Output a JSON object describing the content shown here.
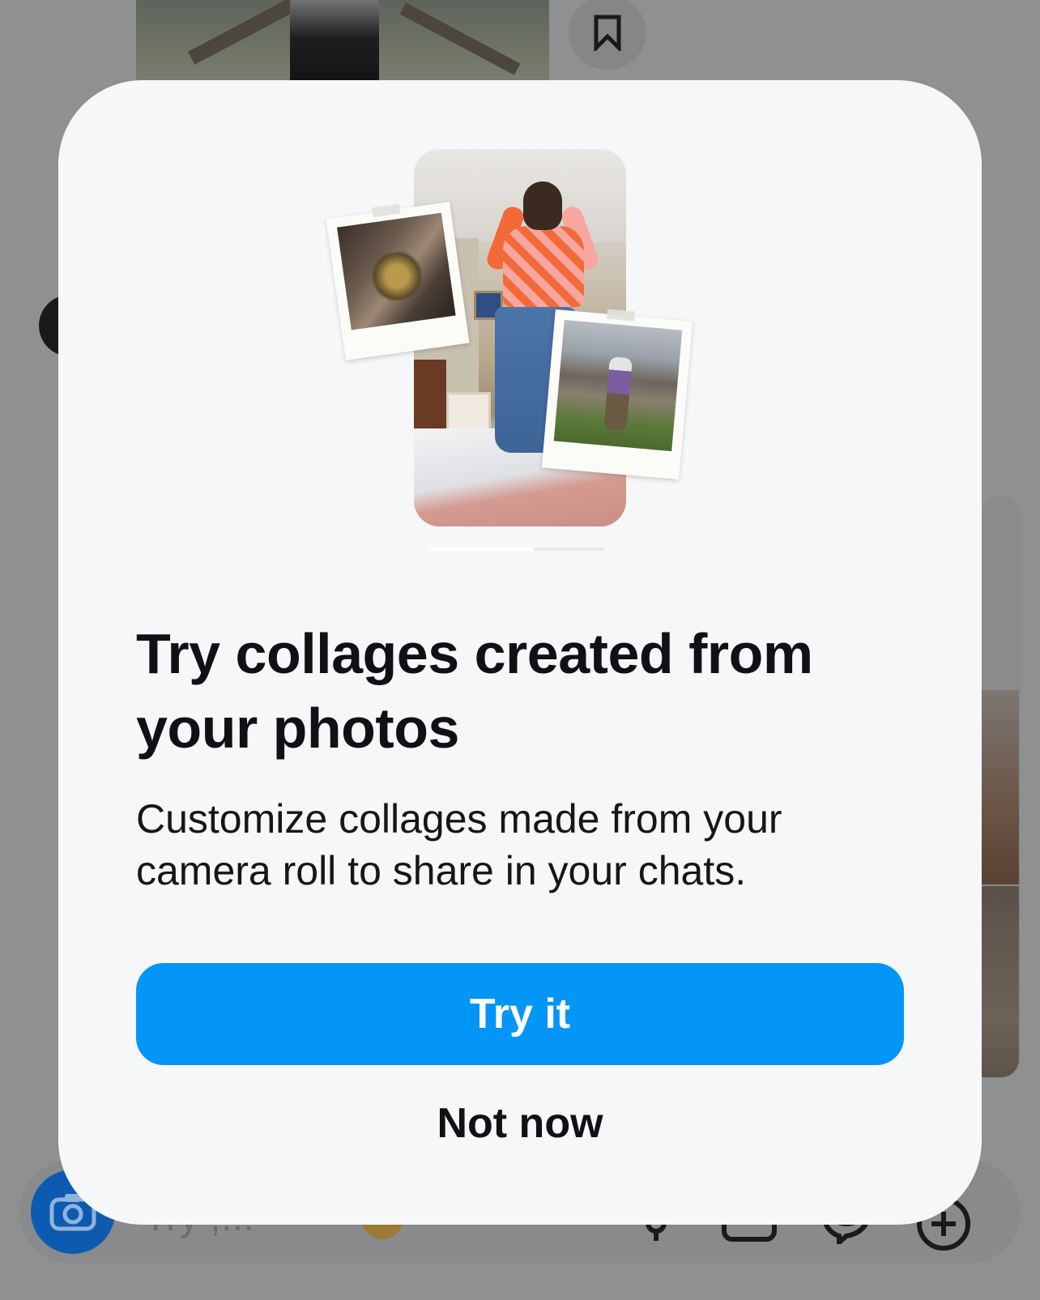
{
  "background": {
    "composer_placeholder": "Try ,...",
    "icons": [
      "bookmark-icon",
      "camera-icon",
      "microphone-icon",
      "image-icon",
      "sticker-icon",
      "plus-icon"
    ]
  },
  "modal": {
    "title": "Try collages created from your photos",
    "body": "Customize collages made from your camera roll to share in your chats.",
    "primary_button": "Try it",
    "secondary_button": "Not now",
    "page_indicator": {
      "pages": 2,
      "current": 1,
      "progress": 0.6
    }
  },
  "colors": {
    "scrim": "#8f9092",
    "modal_bg": "#f5f7f8",
    "primary": "#0396f6",
    "text": "#0f1114",
    "camera_button": "#0d5bb0"
  }
}
